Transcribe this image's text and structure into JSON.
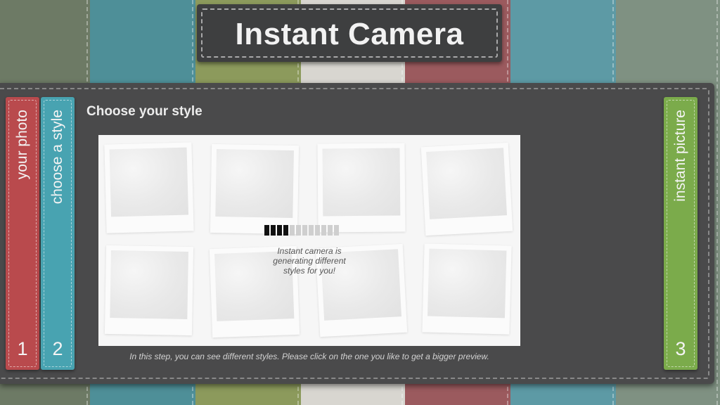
{
  "app": {
    "title": "Instant Camera"
  },
  "steps": [
    {
      "number": "1",
      "label": "your photo",
      "color": "#b94a4d"
    },
    {
      "number": "2",
      "label": "choose a style",
      "color": "#48a3b1"
    },
    {
      "number": "3",
      "label": "instant picture",
      "color": "#7bab4b"
    }
  ],
  "main": {
    "heading": "Choose your style",
    "status_message": "Instant camera is generating different styles for you!",
    "help_text": "In this step, you can see different styles. Please click on the one you like to get a bigger preview.",
    "loading_progress": 0.33,
    "style_thumbnails": 8
  }
}
